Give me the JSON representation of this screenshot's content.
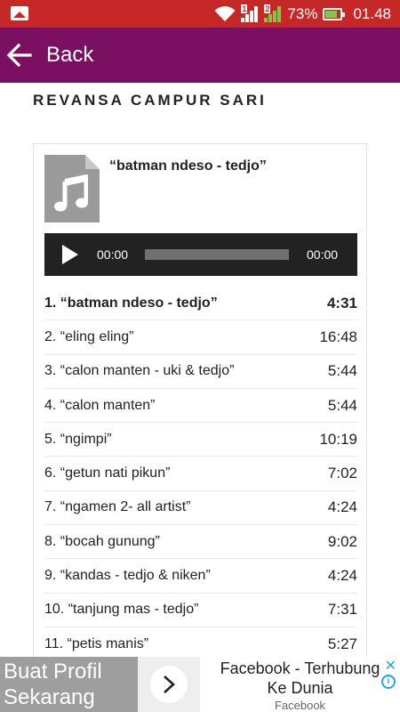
{
  "status_bar": {
    "battery_percent": "73%",
    "time": "01.48",
    "sim1_label": "1",
    "sim2_label": "2",
    "icons": [
      "gallery-notification-icon",
      "wifi-icon",
      "signal-icon",
      "battery-charging-icon"
    ]
  },
  "app_bar": {
    "back_label": "Back",
    "background": "#7b1063"
  },
  "page": {
    "title": "REVANSA CAMPUR SARI"
  },
  "player": {
    "current_title": "“batman ndeso - tedjo”",
    "time_current": "00:00",
    "time_total": "00:00",
    "progress_fraction": 0
  },
  "playlist": [
    {
      "label": "1. “batman ndeso - tedjo”",
      "duration": "4:31"
    },
    {
      "label": "2. “eling eling”",
      "duration": "16:48"
    },
    {
      "label": "3. “calon manten - uki & tedjo”",
      "duration": "5:44"
    },
    {
      "label": "4. “calon manten”",
      "duration": "5:44"
    },
    {
      "label": "5. “ngimpi”",
      "duration": "10:19"
    },
    {
      "label": "6. “getun nati pikun”",
      "duration": "7:02"
    },
    {
      "label": "7. “ngamen 2- all artist”",
      "duration": "4:24"
    },
    {
      "label": "8. “bocah gunung”",
      "duration": "9:02"
    },
    {
      "label": "9. “kandas - tedjo & niken”",
      "duration": "4:24"
    },
    {
      "label": "10. “tanjung mas - tedjo”",
      "duration": "7:31"
    },
    {
      "label": "11. “petis manis”",
      "duration": "5:27"
    }
  ],
  "ad": {
    "left_text_1": "Buat Profil",
    "left_text_2": "Sekarang",
    "headline_1": "Facebook - Terhubung",
    "headline_2": "Ke Dunia",
    "source": "Facebook",
    "close_symbol": "✕",
    "info_symbol": "i"
  },
  "colors": {
    "status_bar": "#c62828",
    "app_bar": "#7b1063",
    "player_bg": "#222222"
  }
}
